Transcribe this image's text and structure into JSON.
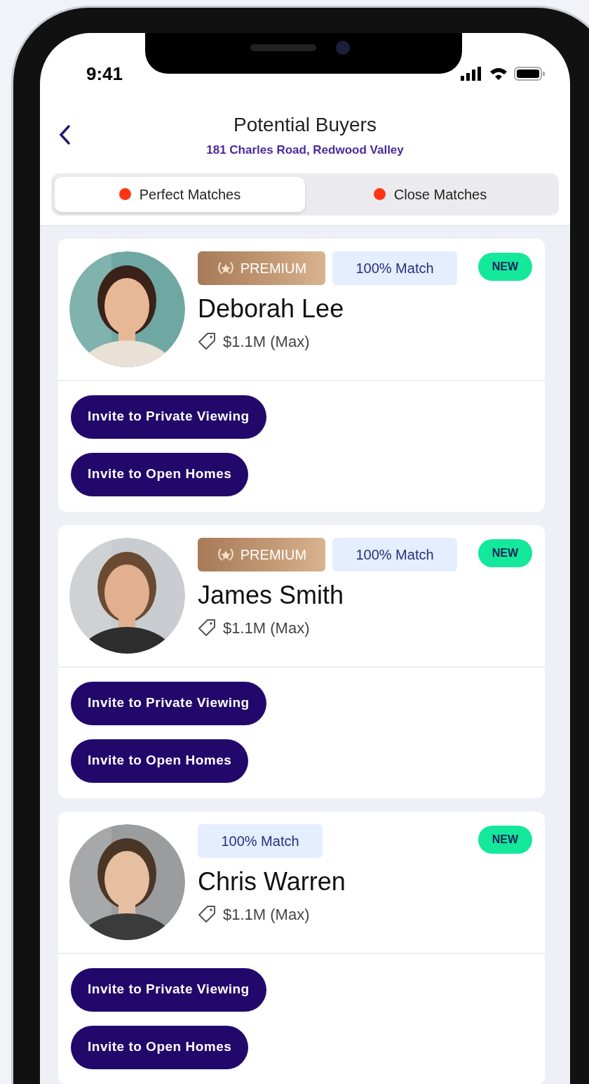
{
  "status_bar": {
    "time": "9:41"
  },
  "header": {
    "title": "Potential Buyers",
    "subtitle": "181 Charles Road, Redwood Valley"
  },
  "tabs": [
    {
      "label": "Perfect Matches",
      "selected": true
    },
    {
      "label": "Close Matches",
      "selected": false
    }
  ],
  "buyers": [
    {
      "name": "Deborah Lee",
      "tags": [
        {
          "kind": "premium",
          "label": "PREMIUM"
        },
        {
          "kind": "match",
          "label": "100% Match"
        }
      ],
      "badge": "NEW",
      "budget": "$1.1M (Max)",
      "actions": [
        "Invite to Private Viewing",
        "Invite to Open Homes"
      ]
    },
    {
      "name": "James Smith",
      "tags": [
        {
          "kind": "premium",
          "label": "PREMIUM"
        },
        {
          "kind": "match",
          "label": "100% Match"
        }
      ],
      "badge": "NEW",
      "budget": "$1.1M (Max)",
      "actions": [
        "Invite to Private Viewing",
        "Invite to Open Homes"
      ]
    },
    {
      "name": "Chris Warren",
      "tags": [
        {
          "kind": "match",
          "label": "100% Match"
        }
      ],
      "badge": "NEW",
      "budget": "$1.1M (Max)",
      "actions": [
        "Invite to Private Viewing",
        "Invite to Open Homes"
      ]
    }
  ]
}
